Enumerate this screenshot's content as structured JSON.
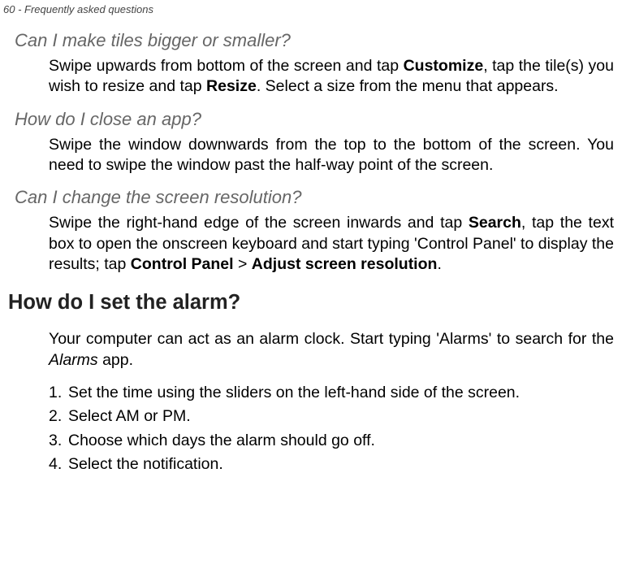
{
  "header": "60 - Frequently asked questions",
  "q1": {
    "title": "Can I make tiles bigger or smaller?",
    "p_pre1": "Swipe upwards from bottom of the screen and tap ",
    "b1": "Customize",
    "p_mid1": ", tap the tile(s) you wish to resize and tap ",
    "b2": "Resize",
    "p_post1": ". Select a size from the menu that appears."
  },
  "q2": {
    "title": "How do I close an app?",
    "p": "Swipe the window downwards from the top to the bottom of the screen. You need to swipe the window past the half-way point of the screen."
  },
  "q3": {
    "title": "Can I change the screen resolution?",
    "p_pre1": "Swipe the right-hand edge of the screen inwards and tap ",
    "b1": "Search",
    "p_mid1": ", tap the text box to open the onscreen keyboard and start typing 'Control Panel' to display the results; tap ",
    "b2": "Control Panel",
    "sep": " > ",
    "b3": "Adjust screen resolution",
    "p_post1": "."
  },
  "h2": "How do I set the alarm?",
  "alarm_intro": {
    "pre": "Your computer can act as an alarm clock. Start typing 'Alarms' to search for the ",
    "app": "Alarms",
    "post": " app."
  },
  "steps": {
    "s1": "Set the time using the sliders on the left-hand side of the screen.",
    "s2": "Select AM or PM.",
    "s3": "Choose which days the alarm should go off.",
    "s4": "Select the notification."
  }
}
